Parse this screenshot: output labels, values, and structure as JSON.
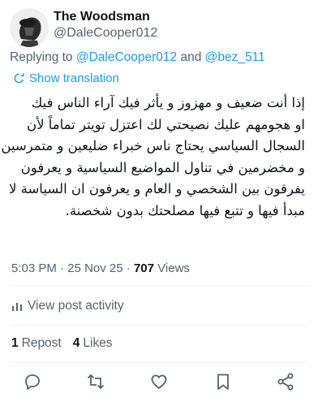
{
  "tweet": {
    "author_name": "The Woodsman",
    "author_handle": "@DaleCooper012",
    "replying_prefix": "Replying to",
    "reply_handle_1": "@DaleCooper012",
    "reply_and": "and",
    "reply_handle_2": "@bez_511",
    "show_translation": "Show translation",
    "lines": [
      "إذا أنت ضعيف و مهزوز و يأثر فيك آراء الناس فيك",
      "او هجومهم عليك نصيحتي لك اعتزل تويتر تماماً لأن",
      "السجال السياسي يحتاج ناس خبراء ضليعين و متمرسين",
      "و مخضرمين في تناول المواضيع السياسية و يعرفون",
      "يفرقون بين الشخصي و العام و يعرفون ان السياسة لا",
      "مبدأ فيها و تتبع فيها مصلحتك بدون شخصنة."
    ],
    "time": "5:03 PM",
    "date": "25 Nov 25",
    "views_count": "707",
    "views_label": "Views",
    "view_activity": "View post activity",
    "reposts_count": "1",
    "reposts_label": "Repost",
    "likes_count": "4",
    "likes_label": "Likes"
  },
  "icons": {
    "reply": "reply-icon",
    "repost": "repost-icon",
    "like": "heart-icon",
    "bookmark": "bookmark-icon",
    "share": "share-icon",
    "translate": "translate-icon",
    "activity": "bar-chart-icon"
  },
  "colors": {
    "accent": "#1d9bf0",
    "muted": "#536471",
    "text": "#0f1419"
  }
}
